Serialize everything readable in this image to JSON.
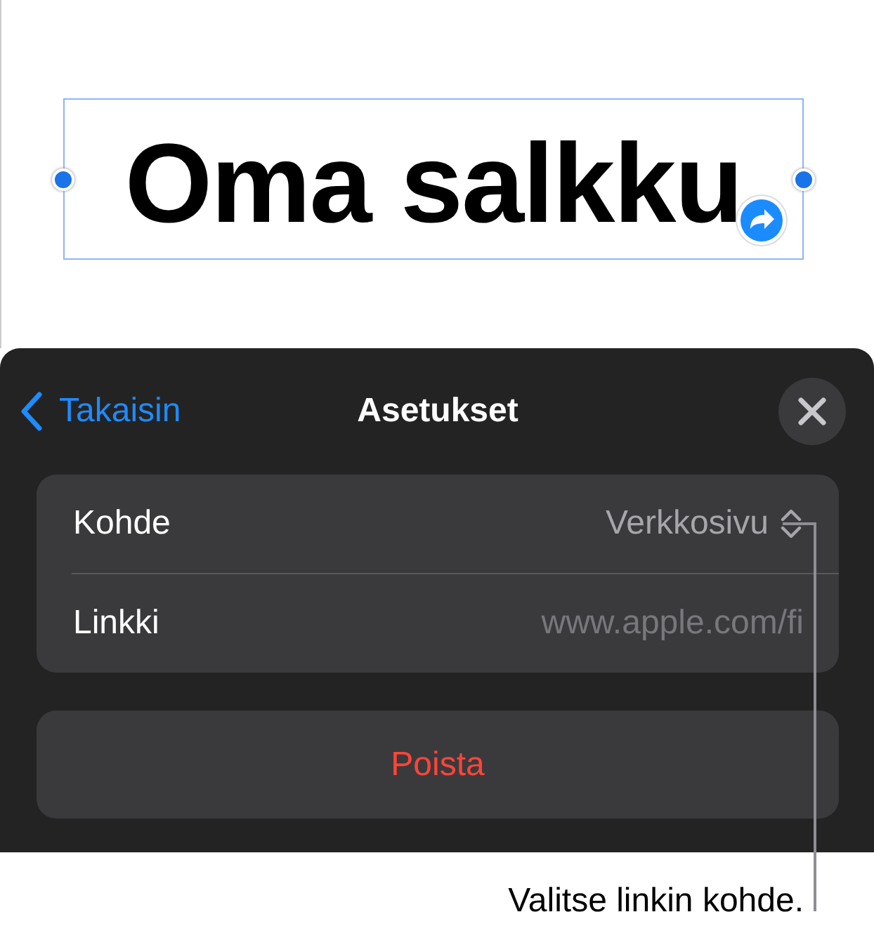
{
  "document": {
    "text": "Oma salkku",
    "selected": true,
    "linked": true
  },
  "panel": {
    "back_label": "Takaisin",
    "title": "Asetukset",
    "rows": [
      {
        "kind": "popup",
        "label": "Kohde",
        "value": "Verkkosivu"
      },
      {
        "kind": "field",
        "label": "Linkki",
        "value": "www.apple.com/fi"
      }
    ],
    "delete_button": "Poista"
  },
  "callout": "Valitse linkin kohde."
}
